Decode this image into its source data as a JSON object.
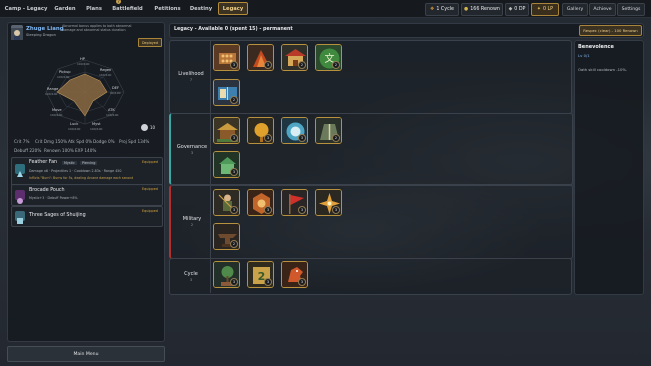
{
  "topbar": {
    "tabs": [
      {
        "label": "Camp - Legacy"
      },
      {
        "label": "Garden"
      },
      {
        "label": "Plans"
      },
      {
        "label": "Battlefield"
      },
      {
        "label": "Petitions"
      },
      {
        "label": "Destiny"
      },
      {
        "label": "Legacy"
      }
    ],
    "plans_badge": "?",
    "resources": {
      "cycle": "1 Cycle",
      "renown": "166 Renown",
      "dp": "0 DP",
      "lp": "0 LP"
    },
    "right_buttons": [
      "Gallery",
      "Achieve",
      "Settings"
    ]
  },
  "hero": {
    "name": "Zhuge Liang",
    "title": "Sleeping Dragon",
    "desc": "Abnormal bonus applies to both abnormal damage and abnormal status duration",
    "deploy_label": "Deployed",
    "radar_axes": [
      {
        "label": "HP",
        "value": "100/100"
      },
      {
        "label": "Regen",
        "value": "100/100"
      },
      {
        "label": "DEF",
        "value": "00/100"
      },
      {
        "label": "ATK",
        "value": "100/100"
      },
      {
        "label": "Myst",
        "value": "100/100"
      },
      {
        "label": "Luck",
        "value": "100/100"
      },
      {
        "label": "Move",
        "value": "100/100"
      },
      {
        "label": "Range",
        "value": "100/100"
      },
      {
        "label": "Pickup",
        "value": "100/100"
      }
    ],
    "level_badge": "10",
    "stats_row1": [
      "Crit 7%",
      "Crit Dmg 150%",
      "Atk Spd 0%",
      "Dodge 0%",
      "Proj Spd 134%"
    ],
    "stats_row2": [
      "Debuff 220%",
      "Renown 100%",
      "EXP 140%"
    ]
  },
  "items": [
    {
      "name": "Feather Fan",
      "tags": [
        "Mystic",
        "Piercing"
      ],
      "equipped": "Equipped",
      "stats": "Damage x6 · Projectiles 1 · Cooldown 2.83s · Range 450",
      "note": "Inflicts \"Burn\": Burns for 5s, dealing Arcane damage each second"
    },
    {
      "name": "Brocade Pouch",
      "equipped": "Equipped",
      "stats": "Mystic+3 · Debuff Power+8%"
    },
    {
      "name": "Three Sages of Shuijing",
      "equipped": "Equipped"
    }
  ],
  "main_menu_label": "Main Menu",
  "legacy": {
    "header": "Legacy - Available 0 (spent 15) - permanent",
    "respec_label": "Respec (clear) - 100 Renown",
    "rows": [
      {
        "name": "Livelihood",
        "count": "7",
        "nodes": [
          {
            "icon": "abacus-icon",
            "level": "3"
          },
          {
            "icon": "grain-pile-icon",
            "level": "3"
          },
          {
            "icon": "palace-icon",
            "level": "2"
          },
          {
            "icon": "calligraphy-icon",
            "level": "2"
          },
          {
            "icon": "book-icon",
            "level": "2"
          }
        ]
      },
      {
        "name": "Governance",
        "count": "3",
        "nodes": [
          {
            "icon": "pavilion-icon",
            "level": "3"
          },
          {
            "icon": "golden-lantern-icon",
            "level": "3"
          },
          {
            "icon": "cloud-seal-icon",
            "level": "3"
          },
          {
            "icon": "robe-icon",
            "level": "2"
          },
          {
            "icon": "jade-temple-icon",
            "level": "3"
          }
        ]
      },
      {
        "name": "Military",
        "count": "2",
        "nodes": [
          {
            "icon": "warrior-icon",
            "level": "3"
          },
          {
            "icon": "bagua-shield-icon",
            "level": "3"
          },
          {
            "icon": "war-banner-icon",
            "level": "3"
          },
          {
            "icon": "compass-star-icon",
            "level": "3"
          },
          {
            "icon": "anvil-icon",
            "level": "2"
          }
        ]
      },
      {
        "name": "Cycle",
        "count": "3",
        "nodes": [
          {
            "icon": "bonsai-icon",
            "level": "3"
          },
          {
            "icon": "scroll-2-icon",
            "level": "3"
          },
          {
            "icon": "fire-horse-icon",
            "level": "3"
          }
        ]
      }
    ]
  },
  "detail": {
    "title": "Benevolence",
    "level": "Lv 0/1",
    "desc": "Oath skill cooldown -10%."
  },
  "colors": {
    "gold": "#c9a24a",
    "panel": "#161a20",
    "accent_red": "#b03030"
  }
}
